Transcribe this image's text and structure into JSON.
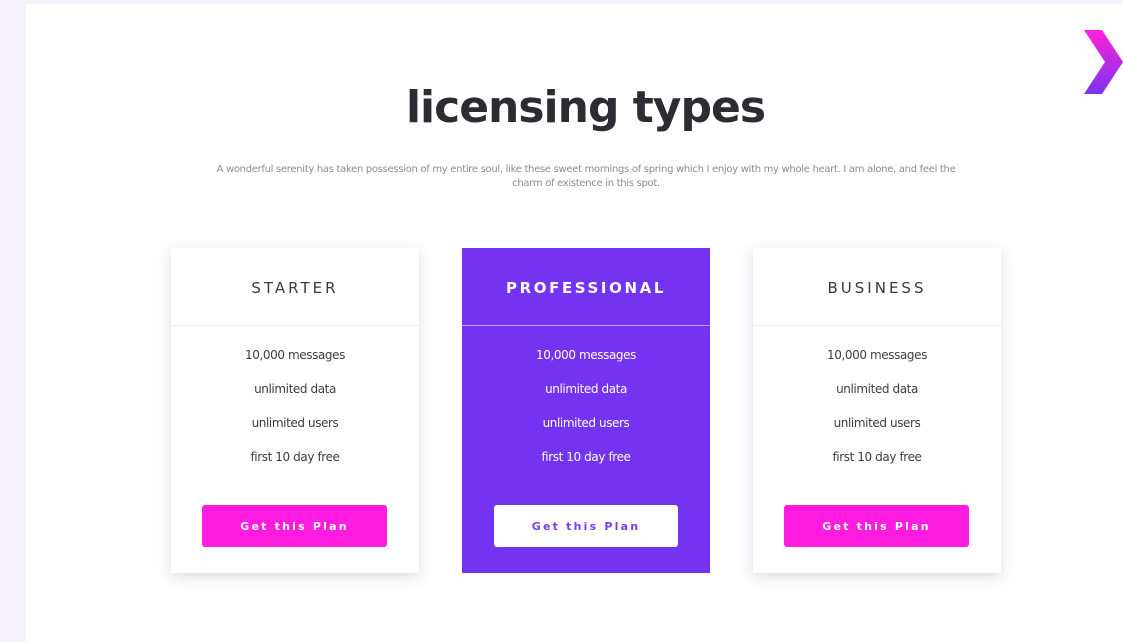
{
  "section": {
    "title": "licensing types",
    "description": "A wonderful serenity has taken possession of my entire soul, like these sweet mornings of spring which I enjoy with my whole heart. I am alone, and feel the charm of existence in this spot."
  },
  "plans": [
    {
      "name": "STARTER",
      "featured": false,
      "features": [
        "10,000 messages",
        "unlimited data",
        "unlimited users",
        "first 10 day free"
      ],
      "button_label": "Get this Plan"
    },
    {
      "name": "PROFESSIONAL",
      "featured": true,
      "features": [
        "10,000 messages",
        "unlimited data",
        "unlimited users",
        "first 10 day free"
      ],
      "button_label": "Get this Plan"
    },
    {
      "name": "BUSINESS",
      "featured": false,
      "features": [
        "10,000 messages",
        "unlimited data",
        "unlimited users",
        "first 10 day free"
      ],
      "button_label": "Get this Plan"
    }
  ],
  "icons": {
    "next": "chevron-right-icon"
  },
  "colors": {
    "accent_purple": "#7433f0",
    "accent_magenta": "#ff1ce0",
    "title": "#2c2c32",
    "text_muted": "#8c8c96"
  }
}
